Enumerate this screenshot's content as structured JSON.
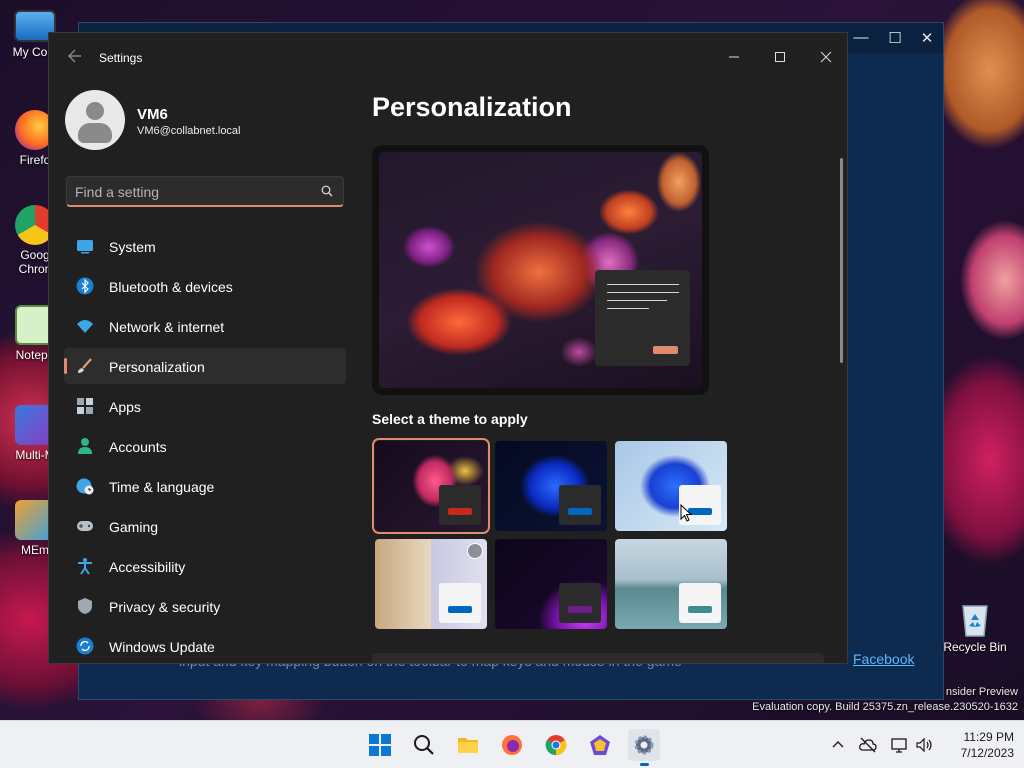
{
  "desktop": {
    "icons": [
      {
        "label": "My Com"
      },
      {
        "label": "Firefo"
      },
      {
        "label": "Goog"
      },
      {
        "label": "Chron"
      },
      {
        "label": "Notepa"
      },
      {
        "label": "Multi-M"
      },
      {
        "label": "MEm"
      }
    ],
    "recycle_bin_label": "Recycle Bin",
    "watermark_line1": "nsider Preview",
    "watermark_line2": "Evaluation copy. Build 25375.zn_release.230520-1632"
  },
  "background_window": {
    "link_text": "Facebook",
    "partial_text": "input and key mapping button on the toolbar to map keys and mouse in the game"
  },
  "settings": {
    "title": "Settings",
    "user": {
      "name": "VM6",
      "email": "VM6@collabnet.local"
    },
    "search": {
      "placeholder": "Find a setting"
    },
    "nav": [
      {
        "label": "System",
        "icon": "system-icon",
        "active": false
      },
      {
        "label": "Bluetooth & devices",
        "icon": "bluetooth-icon",
        "active": false
      },
      {
        "label": "Network & internet",
        "icon": "wifi-icon",
        "active": false
      },
      {
        "label": "Personalization",
        "icon": "brush-icon",
        "active": true
      },
      {
        "label": "Apps",
        "icon": "apps-icon",
        "active": false
      },
      {
        "label": "Accounts",
        "icon": "accounts-icon",
        "active": false
      },
      {
        "label": "Time & language",
        "icon": "globe-clock-icon",
        "active": false
      },
      {
        "label": "Gaming",
        "icon": "gamepad-icon",
        "active": false
      },
      {
        "label": "Accessibility",
        "icon": "accessibility-icon",
        "active": false
      },
      {
        "label": "Privacy & security",
        "icon": "shield-icon",
        "active": false
      },
      {
        "label": "Windows Update",
        "icon": "update-icon",
        "active": false
      }
    ],
    "page_title": "Personalization",
    "themes_heading": "Select a theme to apply",
    "themes": [
      {
        "id": "theme-1",
        "accent": "#c42b1c",
        "selected": true
      },
      {
        "id": "theme-2",
        "accent": "#0067c0",
        "selected": false
      },
      {
        "id": "theme-3",
        "accent": "#0067c0",
        "selected": false
      },
      {
        "id": "theme-4",
        "accent": "#0067c0",
        "selected": false
      },
      {
        "id": "theme-5",
        "accent": "#6b1e8c",
        "selected": false
      },
      {
        "id": "theme-6",
        "accent": "#3d8c91",
        "selected": false
      }
    ],
    "accent_color": "#e08a6e"
  },
  "taskbar": {
    "time": "11:29 PM",
    "date": "7/12/2023",
    "icons": [
      "start-icon",
      "search-icon",
      "file-explorer-icon",
      "firefox-icon",
      "chrome-icon",
      "memu-icon",
      "settings-icon"
    ]
  }
}
